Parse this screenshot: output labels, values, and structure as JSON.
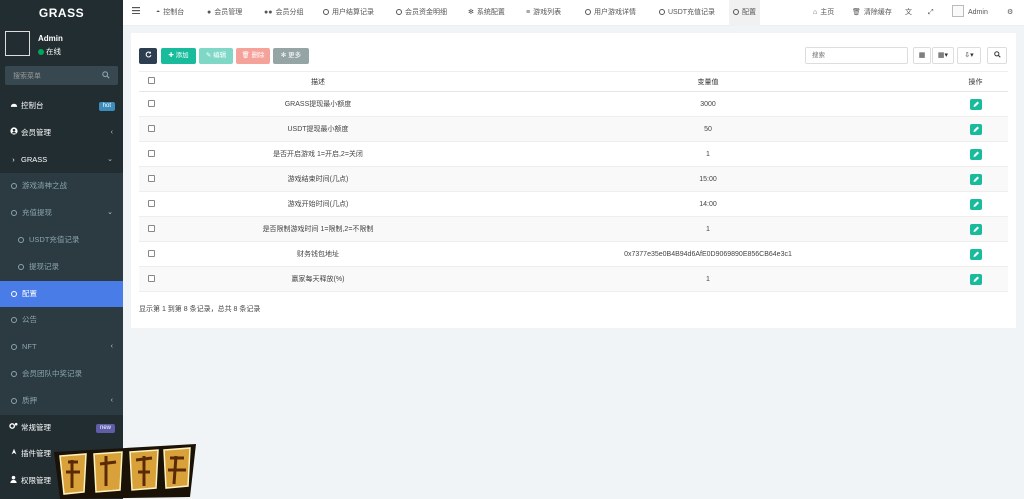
{
  "sidebar": {
    "brand": "GRASS",
    "user": {
      "name": "Admin",
      "status": "在线"
    },
    "search_placeholder": "搜索菜单",
    "items": [
      {
        "label": "控制台",
        "badge": "hot"
      },
      {
        "label": "会员管理"
      },
      {
        "label": "GRASS"
      },
      {
        "label": "游戏清神之战"
      },
      {
        "label": "充值提现"
      },
      {
        "label": "USDT充值记录"
      },
      {
        "label": "提现记录"
      },
      {
        "label": "配置"
      },
      {
        "label": "公告"
      },
      {
        "label": "NFT"
      },
      {
        "label": "会员团队中奖记录"
      },
      {
        "label": "质押"
      },
      {
        "label": "常规管理",
        "badge": "new"
      },
      {
        "label": "插件管理"
      },
      {
        "label": "权限管理"
      }
    ]
  },
  "topbar": {
    "tabs": [
      "控制台",
      "会员管理",
      "会员分组",
      "用户结算记录",
      "会员资金明细",
      "系统配置",
      "游戏列表",
      "用户游戏详情",
      "USDT充值记录",
      "配置"
    ],
    "home": "主页",
    "clear_cache": "清除缓存",
    "user": "Admin"
  },
  "toolbar": {
    "add": "添加",
    "edit": "编辑",
    "delete": "删除",
    "more": "更多",
    "search_placeholder": "搜索"
  },
  "table": {
    "headers": {
      "desc": "描述",
      "value": "变量值",
      "ops": "操作"
    },
    "rows": [
      {
        "desc": "GRASS提现最小额度",
        "value": "3000"
      },
      {
        "desc": "USDT提现最小额度",
        "value": "50"
      },
      {
        "desc": "是否开启游戏 1=开启,2=关闭",
        "value": "1"
      },
      {
        "desc": "游戏结束时间(几点)",
        "value": "15:00"
      },
      {
        "desc": "游戏开始时间(几点)",
        "value": "14:00"
      },
      {
        "desc": "是否限制游戏时间 1=限制,2=不限制",
        "value": "1"
      },
      {
        "desc": "财务钱包地址",
        "value": "0x7377e35e0B4B94d6AfE0D9069890E856CB64e3c1"
      },
      {
        "desc": "赢家每天释放(%)",
        "value": "1"
      }
    ],
    "pagination": "显示第 1 到第 8 条记录，总共 8 条记录"
  },
  "colors": {
    "sidebar_bg": "#222d32",
    "active": "#4a7ce8",
    "btn_refresh": "#2c3e50",
    "btn_add": "#18bc9c",
    "btn_edit": "#7fd8c6",
    "btn_delete": "#f5a29a",
    "btn_more": "#95a5a6"
  }
}
